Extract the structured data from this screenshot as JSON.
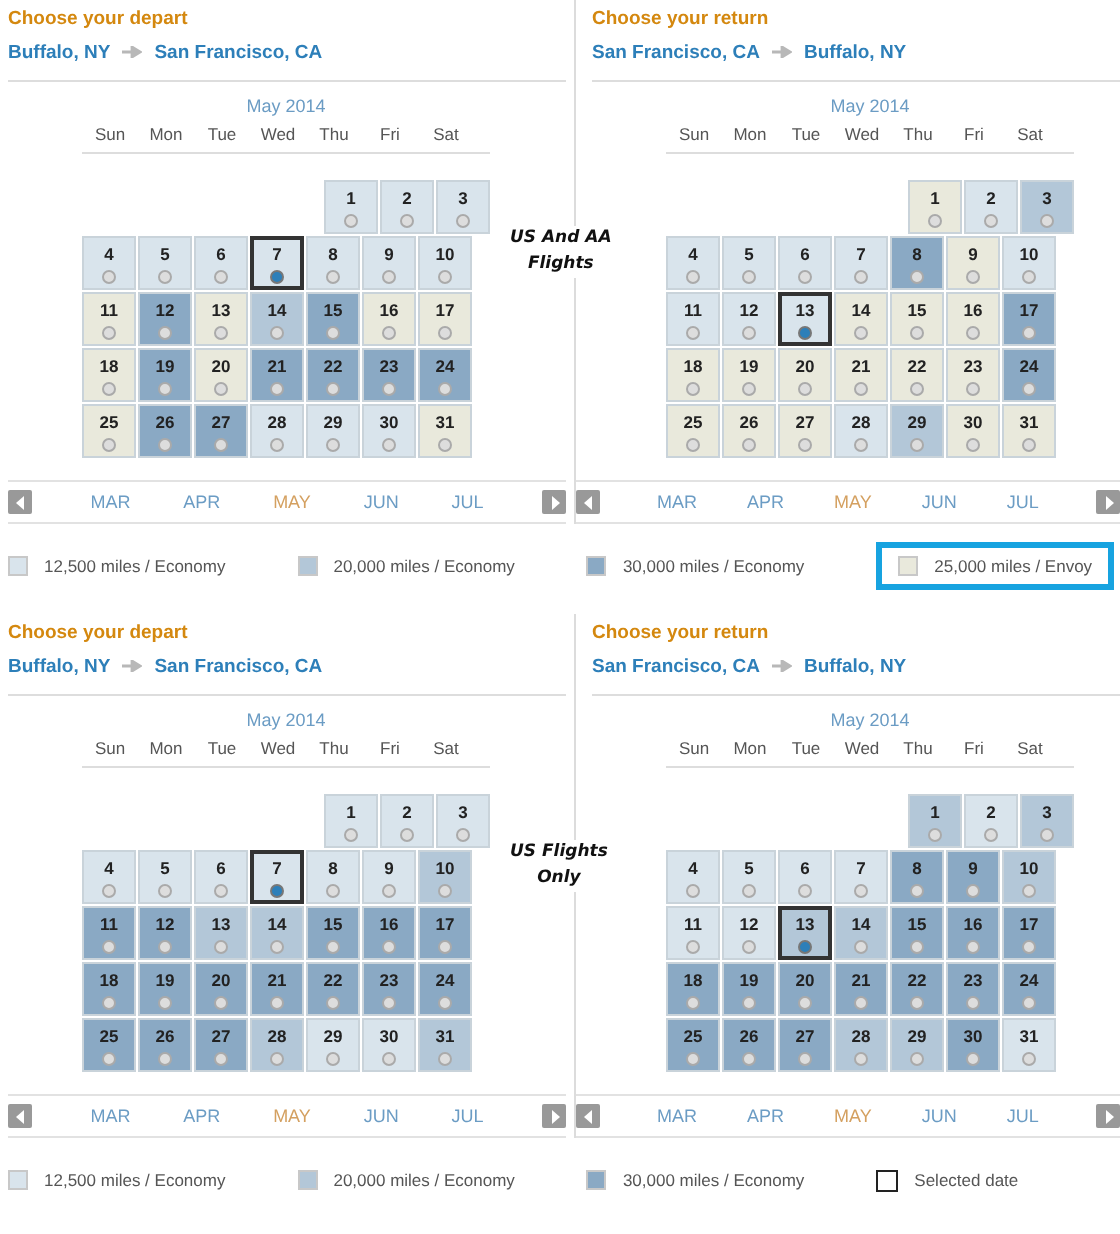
{
  "sections": [
    {
      "annotation": [
        "US And AA",
        "Flights"
      ],
      "panels": [
        {
          "heading": "Choose your depart",
          "origin": "Buffalo, NY",
          "destination": "San Francisco, CA",
          "month": "May 2014",
          "weekdays": [
            "Sun",
            "Mon",
            "Tue",
            "Wed",
            "Thu",
            "Fri",
            "Sat"
          ],
          "weeks": [
            [
              {
                "day": "1",
                "color": "#d9e4ec",
                "selected": false
              },
              {
                "day": "2",
                "color": "#d9e4ec",
                "selected": false
              },
              {
                "day": "3",
                "color": "#d9e4ec",
                "selected": false
              }
            ],
            [
              {
                "day": "4",
                "color": "#d9e4ec",
                "selected": false
              },
              {
                "day": "5",
                "color": "#d9e4ec",
                "selected": false
              },
              {
                "day": "6",
                "color": "#d9e4ec",
                "selected": false
              },
              {
                "day": "7",
                "color": "#d9e4ec",
                "selected": true
              },
              {
                "day": "8",
                "color": "#d9e4ec",
                "selected": false
              },
              {
                "day": "9",
                "color": "#d9e4ec",
                "selected": false
              },
              {
                "day": "10",
                "color": "#d9e4ec",
                "selected": false
              }
            ],
            [
              {
                "day": "11",
                "color": "#e9e9dc",
                "selected": false
              },
              {
                "day": "12",
                "color": "#8aa9c4",
                "selected": false
              },
              {
                "day": "13",
                "color": "#e9e9dc",
                "selected": false
              },
              {
                "day": "14",
                "color": "#b3c7d8",
                "selected": false
              },
              {
                "day": "15",
                "color": "#8aa9c4",
                "selected": false
              },
              {
                "day": "16",
                "color": "#e9e9dc",
                "selected": false
              },
              {
                "day": "17",
                "color": "#e9e9dc",
                "selected": false
              }
            ],
            [
              {
                "day": "18",
                "color": "#e9e9dc",
                "selected": false
              },
              {
                "day": "19",
                "color": "#8aa9c4",
                "selected": false
              },
              {
                "day": "20",
                "color": "#e9e9dc",
                "selected": false
              },
              {
                "day": "21",
                "color": "#8aa9c4",
                "selected": false
              },
              {
                "day": "22",
                "color": "#8aa9c4",
                "selected": false
              },
              {
                "day": "23",
                "color": "#8aa9c4",
                "selected": false
              },
              {
                "day": "24",
                "color": "#8aa9c4",
                "selected": false
              }
            ],
            [
              {
                "day": "25",
                "color": "#e9e9dc",
                "selected": false
              },
              {
                "day": "26",
                "color": "#8aa9c4",
                "selected": false
              },
              {
                "day": "27",
                "color": "#8aa9c4",
                "selected": false
              },
              {
                "day": "28",
                "color": "#d9e4ec",
                "selected": false
              },
              {
                "day": "29",
                "color": "#d9e4ec",
                "selected": false
              },
              {
                "day": "30",
                "color": "#d9e4ec",
                "selected": false
              },
              {
                "day": "31",
                "color": "#e9e9dc",
                "selected": false
              }
            ]
          ],
          "months": [
            {
              "label": "MAR",
              "selected": false
            },
            {
              "label": "APR",
              "selected": false
            },
            {
              "label": "MAY",
              "selected": true
            },
            {
              "label": "JUN",
              "selected": false
            },
            {
              "label": "JUL",
              "selected": false
            }
          ]
        },
        {
          "heading": "Choose your return",
          "origin": "San Francisco, CA",
          "destination": "Buffalo, NY",
          "month": "May 2014",
          "weekdays": [
            "Sun",
            "Mon",
            "Tue",
            "Wed",
            "Thu",
            "Fri",
            "Sat"
          ],
          "weeks": [
            [
              {
                "day": "1",
                "color": "#e9e9dc",
                "selected": false
              },
              {
                "day": "2",
                "color": "#d9e4ec",
                "selected": false
              },
              {
                "day": "3",
                "color": "#b3c7d8",
                "selected": false
              }
            ],
            [
              {
                "day": "4",
                "color": "#d9e4ec",
                "selected": false
              },
              {
                "day": "5",
                "color": "#d9e4ec",
                "selected": false
              },
              {
                "day": "6",
                "color": "#d9e4ec",
                "selected": false
              },
              {
                "day": "7",
                "color": "#d9e4ec",
                "selected": false
              },
              {
                "day": "8",
                "color": "#8aa9c4",
                "selected": false
              },
              {
                "day": "9",
                "color": "#e9e9dc",
                "selected": false
              },
              {
                "day": "10",
                "color": "#d9e4ec",
                "selected": false
              }
            ],
            [
              {
                "day": "11",
                "color": "#d9e4ec",
                "selected": false
              },
              {
                "day": "12",
                "color": "#d9e4ec",
                "selected": false
              },
              {
                "day": "13",
                "color": "#d9e4ec",
                "selected": true
              },
              {
                "day": "14",
                "color": "#e9e9dc",
                "selected": false
              },
              {
                "day": "15",
                "color": "#e9e9dc",
                "selected": false
              },
              {
                "day": "16",
                "color": "#e9e9dc",
                "selected": false
              },
              {
                "day": "17",
                "color": "#8aa9c4",
                "selected": false
              }
            ],
            [
              {
                "day": "18",
                "color": "#e9e9dc",
                "selected": false
              },
              {
                "day": "19",
                "color": "#e9e9dc",
                "selected": false
              },
              {
                "day": "20",
                "color": "#e9e9dc",
                "selected": false
              },
              {
                "day": "21",
                "color": "#e9e9dc",
                "selected": false
              },
              {
                "day": "22",
                "color": "#e9e9dc",
                "selected": false
              },
              {
                "day": "23",
                "color": "#e9e9dc",
                "selected": false
              },
              {
                "day": "24",
                "color": "#8aa9c4",
                "selected": false
              }
            ],
            [
              {
                "day": "25",
                "color": "#e9e9dc",
                "selected": false
              },
              {
                "day": "26",
                "color": "#e9e9dc",
                "selected": false
              },
              {
                "day": "27",
                "color": "#e9e9dc",
                "selected": false
              },
              {
                "day": "28",
                "color": "#d9e4ec",
                "selected": false
              },
              {
                "day": "29",
                "color": "#b3c7d8",
                "selected": false
              },
              {
                "day": "30",
                "color": "#e9e9dc",
                "selected": false
              },
              {
                "day": "31",
                "color": "#e9e9dc",
                "selected": false
              }
            ]
          ],
          "months": [
            {
              "label": "MAR",
              "selected": false
            },
            {
              "label": "APR",
              "selected": false
            },
            {
              "label": "MAY",
              "selected": true
            },
            {
              "label": "JUN",
              "selected": false
            },
            {
              "label": "JUL",
              "selected": false
            }
          ]
        }
      ],
      "legend": [
        {
          "kind": "swatch",
          "color": "#d9e4ec",
          "label": "12,500 miles / Economy",
          "highlighted": false
        },
        {
          "kind": "swatch",
          "color": "#b3c7d8",
          "label": "20,000 miles / Economy",
          "highlighted": false
        },
        {
          "kind": "swatch",
          "color": "#8aa9c4",
          "label": "30,000 miles / Economy",
          "highlighted": false
        },
        {
          "kind": "swatch",
          "color": "#e9e9dc",
          "label": "25,000 miles / Envoy",
          "highlighted": true
        }
      ]
    },
    {
      "annotation": [
        "US Flights",
        "Only"
      ],
      "panels": [
        {
          "heading": "Choose your depart",
          "origin": "Buffalo, NY",
          "destination": "San Francisco, CA",
          "month": "May 2014",
          "weekdays": [
            "Sun",
            "Mon",
            "Tue",
            "Wed",
            "Thu",
            "Fri",
            "Sat"
          ],
          "weeks": [
            [
              {
                "day": "1",
                "color": "#d9e4ec",
                "selected": false
              },
              {
                "day": "2",
                "color": "#d9e4ec",
                "selected": false
              },
              {
                "day": "3",
                "color": "#d9e4ec",
                "selected": false
              }
            ],
            [
              {
                "day": "4",
                "color": "#d9e4ec",
                "selected": false
              },
              {
                "day": "5",
                "color": "#d9e4ec",
                "selected": false
              },
              {
                "day": "6",
                "color": "#d9e4ec",
                "selected": false
              },
              {
                "day": "7",
                "color": "#d9e4ec",
                "selected": true
              },
              {
                "day": "8",
                "color": "#d9e4ec",
                "selected": false
              },
              {
                "day": "9",
                "color": "#d9e4ec",
                "selected": false
              },
              {
                "day": "10",
                "color": "#b3c7d8",
                "selected": false
              }
            ],
            [
              {
                "day": "11",
                "color": "#8aa9c4",
                "selected": false
              },
              {
                "day": "12",
                "color": "#8aa9c4",
                "selected": false
              },
              {
                "day": "13",
                "color": "#b3c7d8",
                "selected": false
              },
              {
                "day": "14",
                "color": "#b3c7d8",
                "selected": false
              },
              {
                "day": "15",
                "color": "#8aa9c4",
                "selected": false
              },
              {
                "day": "16",
                "color": "#8aa9c4",
                "selected": false
              },
              {
                "day": "17",
                "color": "#8aa9c4",
                "selected": false
              }
            ],
            [
              {
                "day": "18",
                "color": "#8aa9c4",
                "selected": false
              },
              {
                "day": "19",
                "color": "#8aa9c4",
                "selected": false
              },
              {
                "day": "20",
                "color": "#8aa9c4",
                "selected": false
              },
              {
                "day": "21",
                "color": "#8aa9c4",
                "selected": false
              },
              {
                "day": "22",
                "color": "#8aa9c4",
                "selected": false
              },
              {
                "day": "23",
                "color": "#8aa9c4",
                "selected": false
              },
              {
                "day": "24",
                "color": "#8aa9c4",
                "selected": false
              }
            ],
            [
              {
                "day": "25",
                "color": "#8aa9c4",
                "selected": false
              },
              {
                "day": "26",
                "color": "#8aa9c4",
                "selected": false
              },
              {
                "day": "27",
                "color": "#8aa9c4",
                "selected": false
              },
              {
                "day": "28",
                "color": "#b3c7d8",
                "selected": false
              },
              {
                "day": "29",
                "color": "#d9e4ec",
                "selected": false
              },
              {
                "day": "30",
                "color": "#d9e4ec",
                "selected": false
              },
              {
                "day": "31",
                "color": "#b3c7d8",
                "selected": false
              }
            ]
          ],
          "months": [
            {
              "label": "MAR",
              "selected": false
            },
            {
              "label": "APR",
              "selected": false
            },
            {
              "label": "MAY",
              "selected": true
            },
            {
              "label": "JUN",
              "selected": false
            },
            {
              "label": "JUL",
              "selected": false
            }
          ]
        },
        {
          "heading": "Choose your return",
          "origin": "San Francisco, CA",
          "destination": "Buffalo, NY",
          "month": "May 2014",
          "weekdays": [
            "Sun",
            "Mon",
            "Tue",
            "Wed",
            "Thu",
            "Fri",
            "Sat"
          ],
          "weeks": [
            [
              {
                "day": "1",
                "color": "#b3c7d8",
                "selected": false
              },
              {
                "day": "2",
                "color": "#d9e4ec",
                "selected": false
              },
              {
                "day": "3",
                "color": "#b3c7d8",
                "selected": false
              }
            ],
            [
              {
                "day": "4",
                "color": "#d9e4ec",
                "selected": false
              },
              {
                "day": "5",
                "color": "#d9e4ec",
                "selected": false
              },
              {
                "day": "6",
                "color": "#d9e4ec",
                "selected": false
              },
              {
                "day": "7",
                "color": "#d9e4ec",
                "selected": false
              },
              {
                "day": "8",
                "color": "#8aa9c4",
                "selected": false
              },
              {
                "day": "9",
                "color": "#8aa9c4",
                "selected": false
              },
              {
                "day": "10",
                "color": "#b3c7d8",
                "selected": false
              }
            ],
            [
              {
                "day": "11",
                "color": "#d9e4ec",
                "selected": false
              },
              {
                "day": "12",
                "color": "#d9e4ec",
                "selected": false
              },
              {
                "day": "13",
                "color": "#b3c7d8",
                "selected": true
              },
              {
                "day": "14",
                "color": "#b3c7d8",
                "selected": false
              },
              {
                "day": "15",
                "color": "#8aa9c4",
                "selected": false
              },
              {
                "day": "16",
                "color": "#8aa9c4",
                "selected": false
              },
              {
                "day": "17",
                "color": "#8aa9c4",
                "selected": false
              }
            ],
            [
              {
                "day": "18",
                "color": "#8aa9c4",
                "selected": false
              },
              {
                "day": "19",
                "color": "#8aa9c4",
                "selected": false
              },
              {
                "day": "20",
                "color": "#8aa9c4",
                "selected": false
              },
              {
                "day": "21",
                "color": "#8aa9c4",
                "selected": false
              },
              {
                "day": "22",
                "color": "#8aa9c4",
                "selected": false
              },
              {
                "day": "23",
                "color": "#8aa9c4",
                "selected": false
              },
              {
                "day": "24",
                "color": "#8aa9c4",
                "selected": false
              }
            ],
            [
              {
                "day": "25",
                "color": "#8aa9c4",
                "selected": false
              },
              {
                "day": "26",
                "color": "#8aa9c4",
                "selected": false
              },
              {
                "day": "27",
                "color": "#8aa9c4",
                "selected": false
              },
              {
                "day": "28",
                "color": "#b3c7d8",
                "selected": false
              },
              {
                "day": "29",
                "color": "#b3c7d8",
                "selected": false
              },
              {
                "day": "30",
                "color": "#8aa9c4",
                "selected": false
              },
              {
                "day": "31",
                "color": "#d9e4ec",
                "selected": false
              }
            ]
          ],
          "months": [
            {
              "label": "MAR",
              "selected": false
            },
            {
              "label": "APR",
              "selected": false
            },
            {
              "label": "MAY",
              "selected": true
            },
            {
              "label": "JUN",
              "selected": false
            },
            {
              "label": "JUL",
              "selected": false
            }
          ]
        }
      ],
      "legend": [
        {
          "kind": "swatch",
          "color": "#d9e4ec",
          "label": "12,500 miles / Economy",
          "highlighted": false
        },
        {
          "kind": "swatch",
          "color": "#b3c7d8",
          "label": "20,000 miles / Economy",
          "highlighted": false
        },
        {
          "kind": "swatch",
          "color": "#8aa9c4",
          "label": "30,000 miles / Economy",
          "highlighted": false
        },
        {
          "kind": "outline",
          "label": "Selected date",
          "highlighted": false
        }
      ]
    }
  ]
}
